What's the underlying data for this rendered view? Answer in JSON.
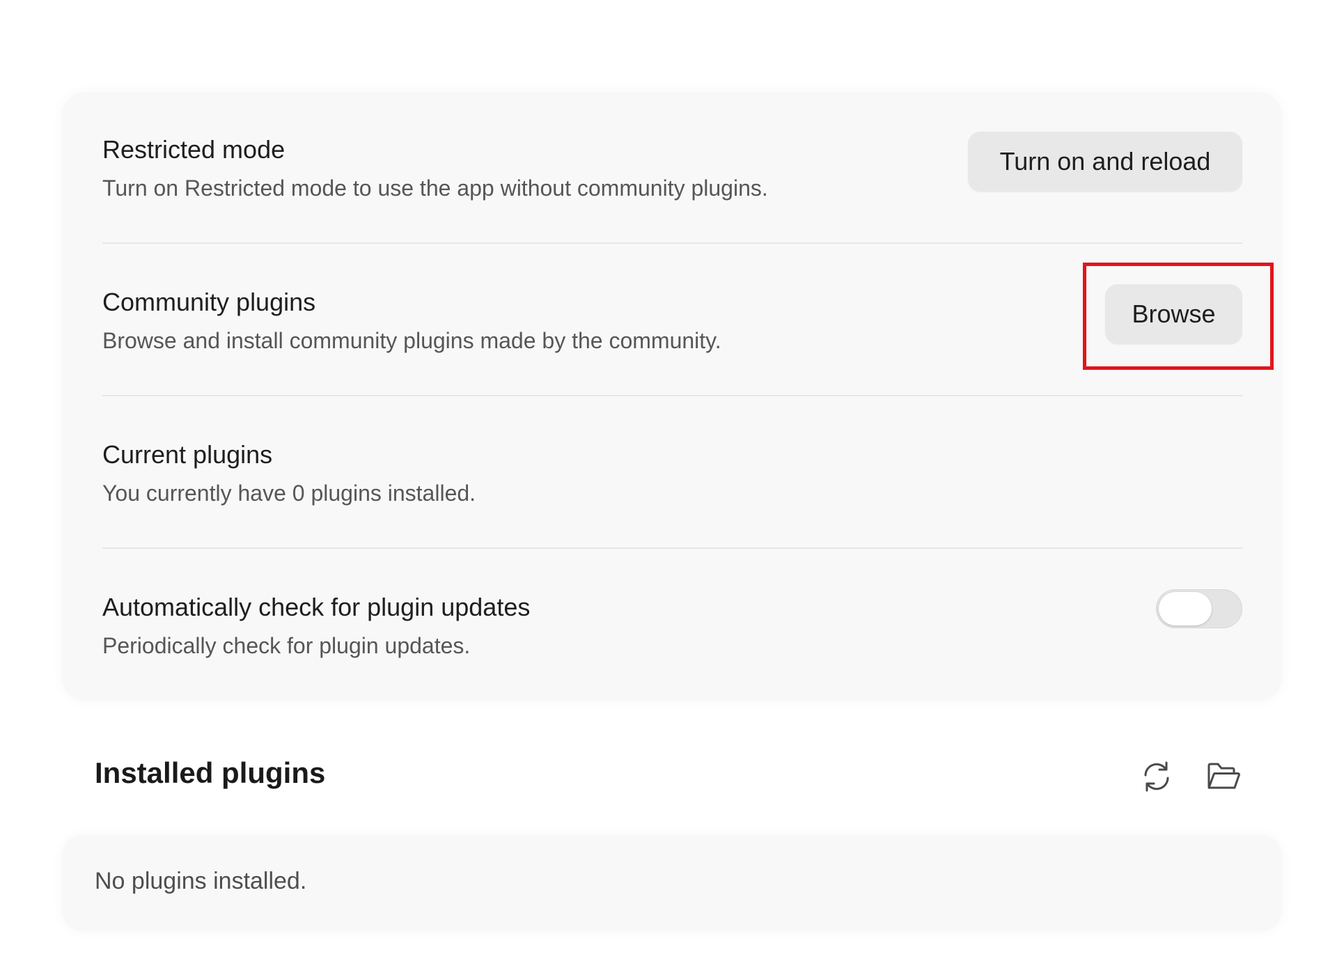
{
  "settings": {
    "restricted_mode": {
      "title": "Restricted mode",
      "description": "Turn on Restricted mode to use the app without community plugins.",
      "button_label": "Turn on and reload"
    },
    "community_plugins": {
      "title": "Community plugins",
      "description": "Browse and install community plugins made by the community.",
      "button_label": "Browse",
      "highlighted": true,
      "highlight_color": "#e3141b"
    },
    "current_plugins": {
      "title": "Current plugins",
      "description": "You currently have 0 plugins installed."
    },
    "auto_update": {
      "title": "Automatically check for plugin updates",
      "description": "Periodically check for plugin updates.",
      "toggle_on": false
    }
  },
  "installed_plugins": {
    "heading": "Installed plugins",
    "icons": [
      "reload-icon",
      "folder-icon"
    ],
    "empty_message": "No plugins installed."
  }
}
